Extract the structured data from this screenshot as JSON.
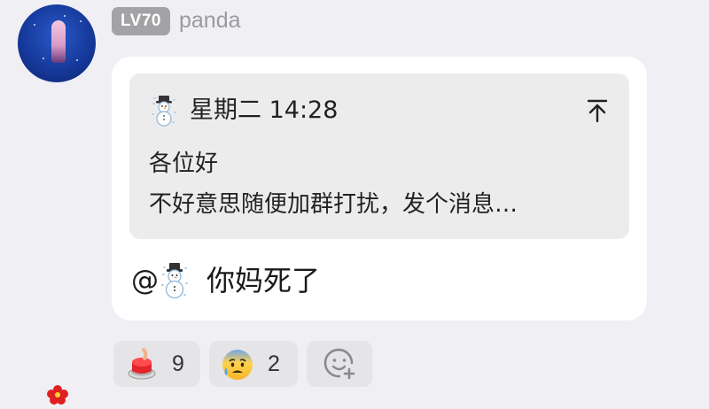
{
  "user": {
    "level": "LV70",
    "name": "panda"
  },
  "quote": {
    "sender_emoji": "snowman-icon",
    "timestamp": "星期二 14:28",
    "line1": "各位好",
    "line2": "不好意思随便加群打扰，发个消息…"
  },
  "message": {
    "mention_prefix": "@",
    "mention_emoji": "snowman-icon",
    "text": "你妈死了"
  },
  "reactions": [
    {
      "emoji": "red-button-icon",
      "count": "9"
    },
    {
      "emoji": "anxious-sweat-face-icon",
      "count": "2"
    },
    {
      "emoji": "add-reaction-icon"
    }
  ],
  "colors": {
    "background": "#f0eff4",
    "bubble": "#ffffff",
    "quote_bg": "#ececec",
    "badge": "#a3a3a6",
    "username": "#9a9aa0",
    "reaction_bg": "#e5e5e8"
  }
}
